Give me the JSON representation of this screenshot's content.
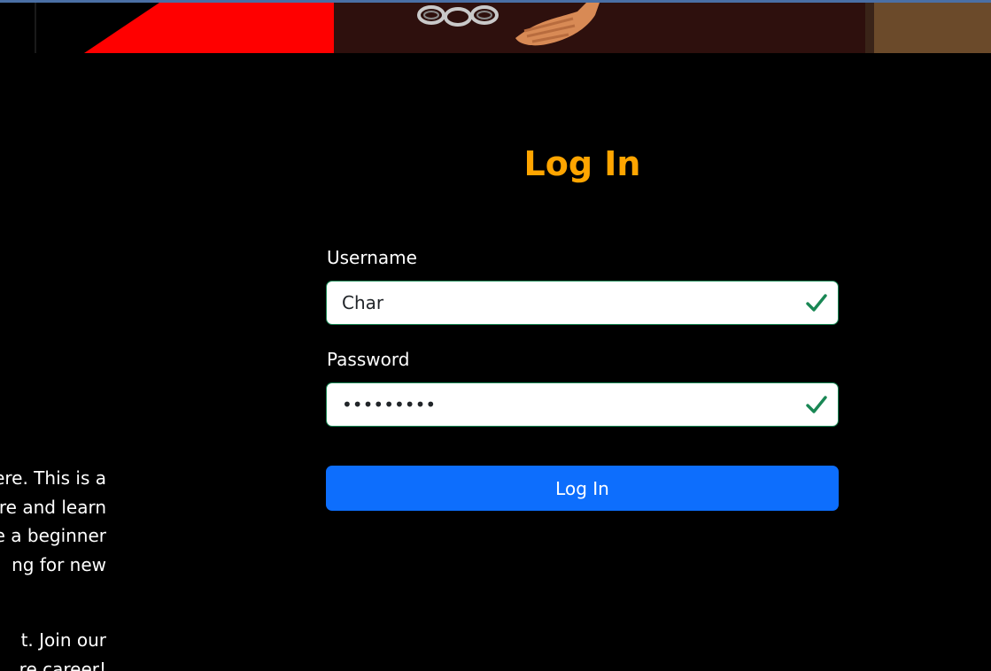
{
  "colors": {
    "title": "#ffa500",
    "primary_button": "#0d6efd",
    "valid_border": "#198754",
    "background": "#000000",
    "banner_red": "#ff0000"
  },
  "intro": {
    "lines_paragraph_1": [
      "ere. This is a",
      "are and learn",
      "e a beginner",
      "ng for new"
    ],
    "lines_paragraph_2": [
      "t. Join our",
      "re career!"
    ]
  },
  "login": {
    "title": "Log In",
    "username": {
      "label": "Username",
      "value": "Char",
      "status_icon": "check-icon"
    },
    "password": {
      "label": "Password",
      "value": "•••••••••",
      "status_icon": "check-icon"
    },
    "submit_label": "Log In"
  }
}
